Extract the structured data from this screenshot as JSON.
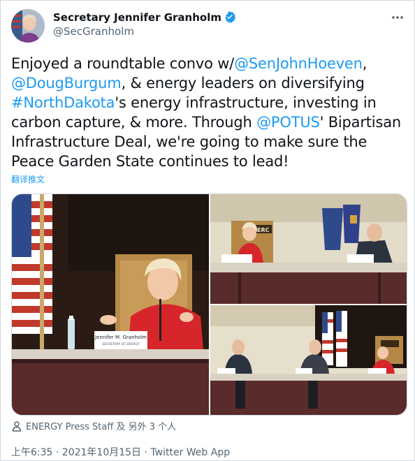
{
  "author": {
    "name": "Secretary Jennifer Granholm",
    "handle": "@SecGranholm",
    "avatar_icon": "avatar",
    "verified_icon": "verified-badge-icon"
  },
  "tweet": {
    "t1": "Enjoyed a roundtable convo w/",
    "m1": "@SenJohnHoeven",
    "t2": ",\n",
    "m2": "@DougBurgum",
    "t3": ", & energy leaders on diversifying\n",
    "m3": "#NorthDakota",
    "t4": "'s energy infrastructure, investing in\ncarbon capture, & more. Through ",
    "m4": "@POTUS",
    "t5": "' Bipartisan\nInfrastructure Deal, we're going to make sure the\nPeace Garden State continues to lead!",
    "translate": "翻译推文"
  },
  "media": {
    "photo1_nameplate": "Jennifer M. Granholm",
    "photo1_subplate": "SECRETARY OF ENERGY",
    "photo2_sign": "EERC"
  },
  "tagged": {
    "text": "ENERGY Press Staff 及 另外 3 个人",
    "icon": "person-icon"
  },
  "meta": {
    "text": "上午6:35 · 2021年10月15日 · Twitter Web App"
  },
  "colors": {
    "link": "#1d9bf0",
    "muted": "#536471"
  }
}
